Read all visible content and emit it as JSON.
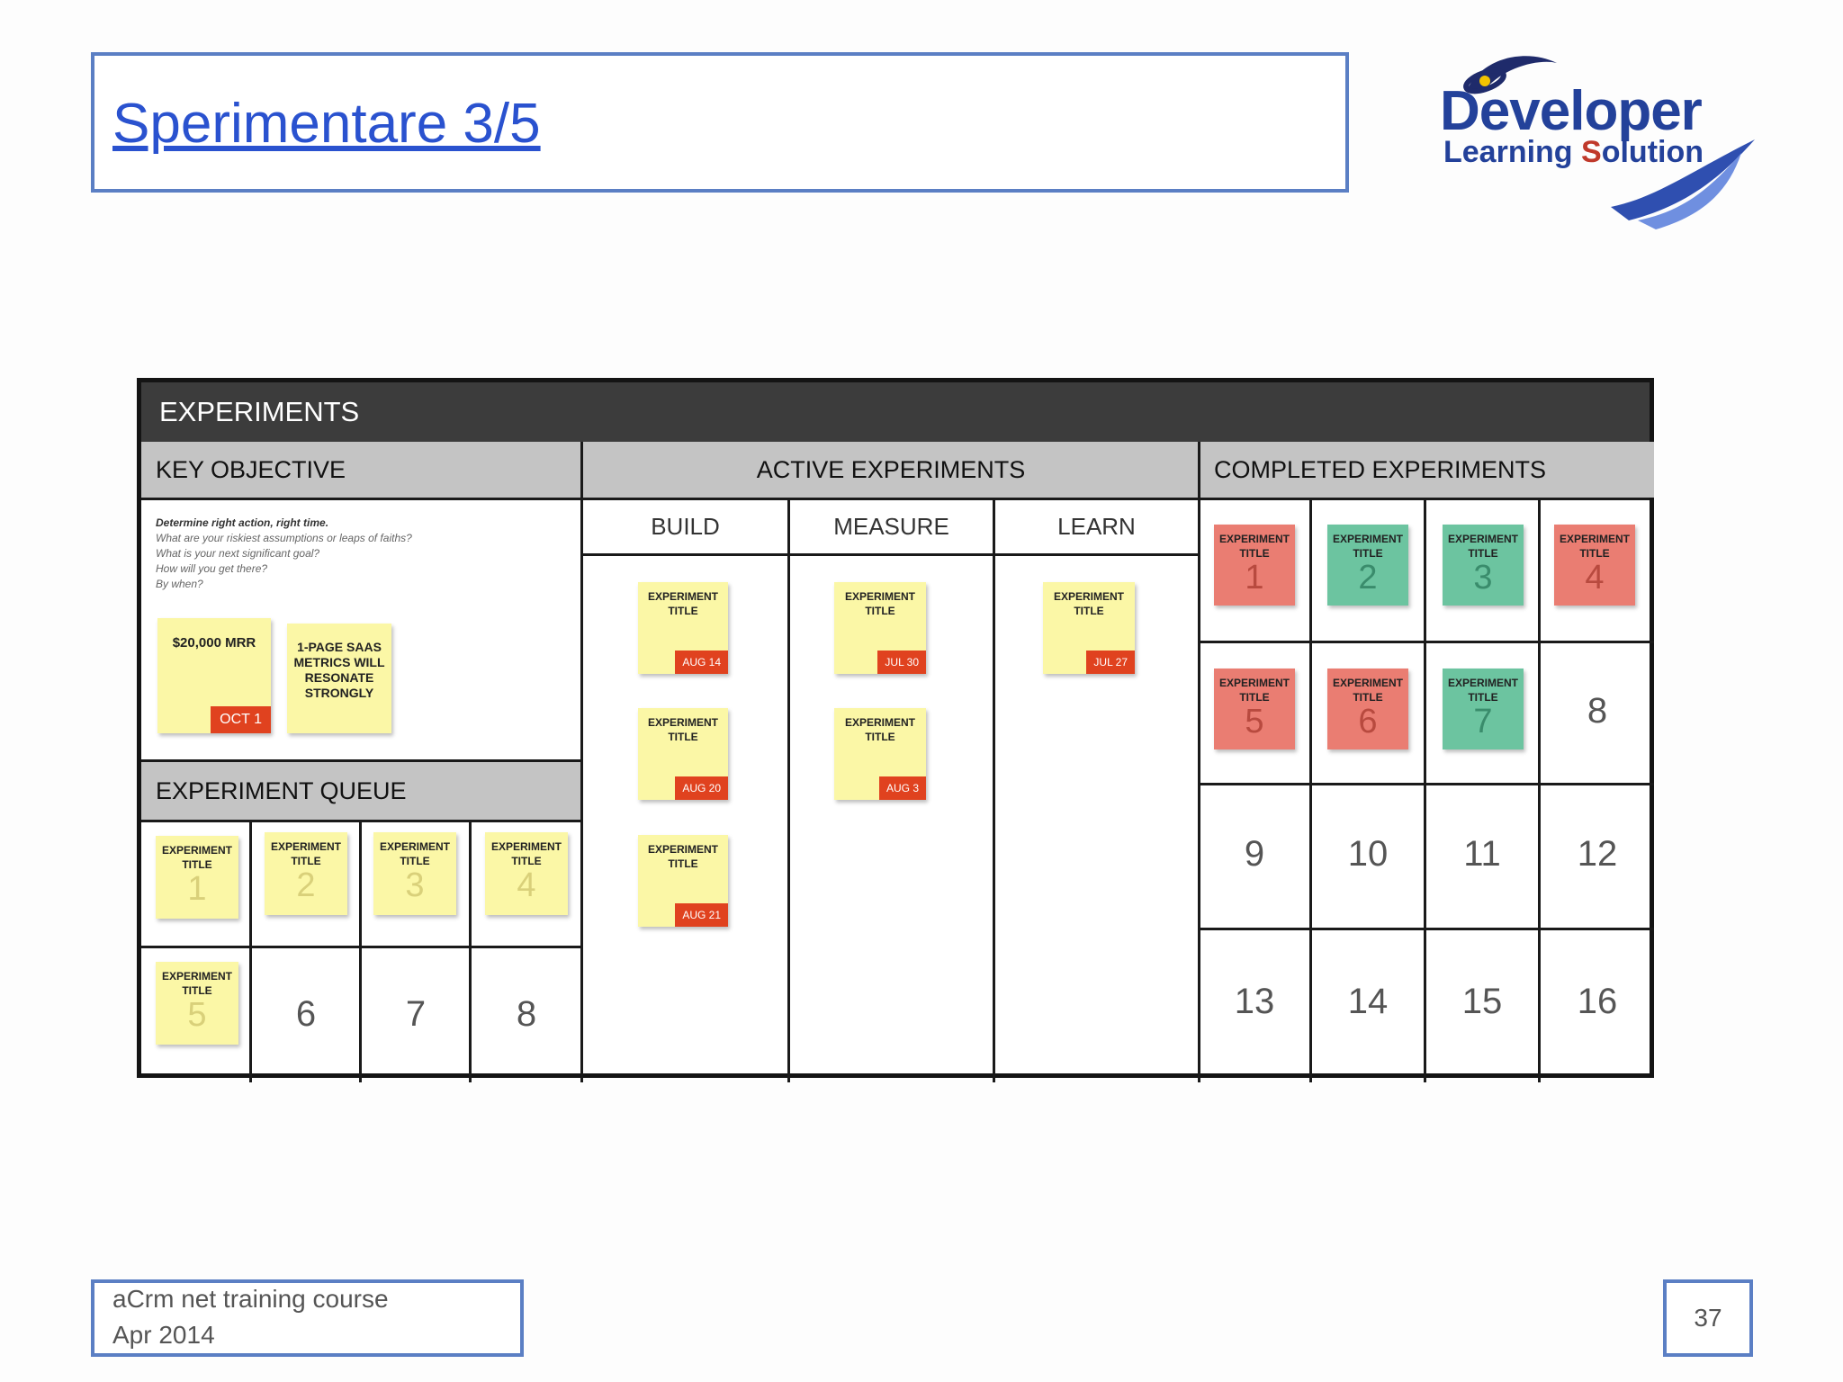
{
  "slide": {
    "title": "Sperimentare 3/5",
    "page_number": "37",
    "footer_line1": "aCrm net training course",
    "footer_line2": "Apr 2014"
  },
  "logo": {
    "word1": "Developer",
    "word2_prefix": "Learning ",
    "word2_accent": "S",
    "word2_suffix": "olution"
  },
  "board": {
    "title": "EXPERIMENTS",
    "key_objective": {
      "heading": "KEY OBJECTIVE",
      "hint_title": "Determine right action, right time.",
      "hint_lines": [
        "What are your riskiest assumptions or leaps of faiths?",
        "What is your next significant goal?",
        "How will you get there?",
        "By when?"
      ],
      "goal_note": "$20,000 MRR",
      "goal_tag": "OCT 1",
      "hypothesis_note": "1-PAGE SAAS METRICS WILL RESONATE STRONGLY"
    },
    "queue": {
      "heading": "EXPERIMENT QUEUE",
      "note_label": "EXPERIMENT TITLE",
      "notes": [
        "1",
        "2",
        "3",
        "4",
        "5"
      ],
      "empty_slots": [
        "6",
        "7",
        "8"
      ]
    },
    "active": {
      "heading": "ACTIVE EXPERIMENTS",
      "columns": [
        "BUILD",
        "MEASURE",
        "LEARN"
      ],
      "note_label": "EXPERIMENT TITLE",
      "build_tags": [
        "AUG 14",
        "AUG 20",
        "AUG 21"
      ],
      "measure_tags": [
        "JUL 30",
        "AUG 3"
      ],
      "learn_tags": [
        "JUL 27"
      ]
    },
    "completed": {
      "heading": "COMPLETED EXPERIMENTS",
      "note_label": "EXPERIMENT TITLE",
      "notes": [
        {
          "num": "1",
          "color": "red"
        },
        {
          "num": "2",
          "color": "green"
        },
        {
          "num": "3",
          "color": "green"
        },
        {
          "num": "4",
          "color": "red"
        },
        {
          "num": "5",
          "color": "red"
        },
        {
          "num": "6",
          "color": "red"
        },
        {
          "num": "7",
          "color": "green"
        }
      ],
      "empty_slots": [
        "8",
        "9",
        "10",
        "11",
        "12",
        "13",
        "14",
        "15",
        "16"
      ],
      "colors": {
        "red": "#ea7d72",
        "green": "#6cc4a0"
      }
    }
  }
}
